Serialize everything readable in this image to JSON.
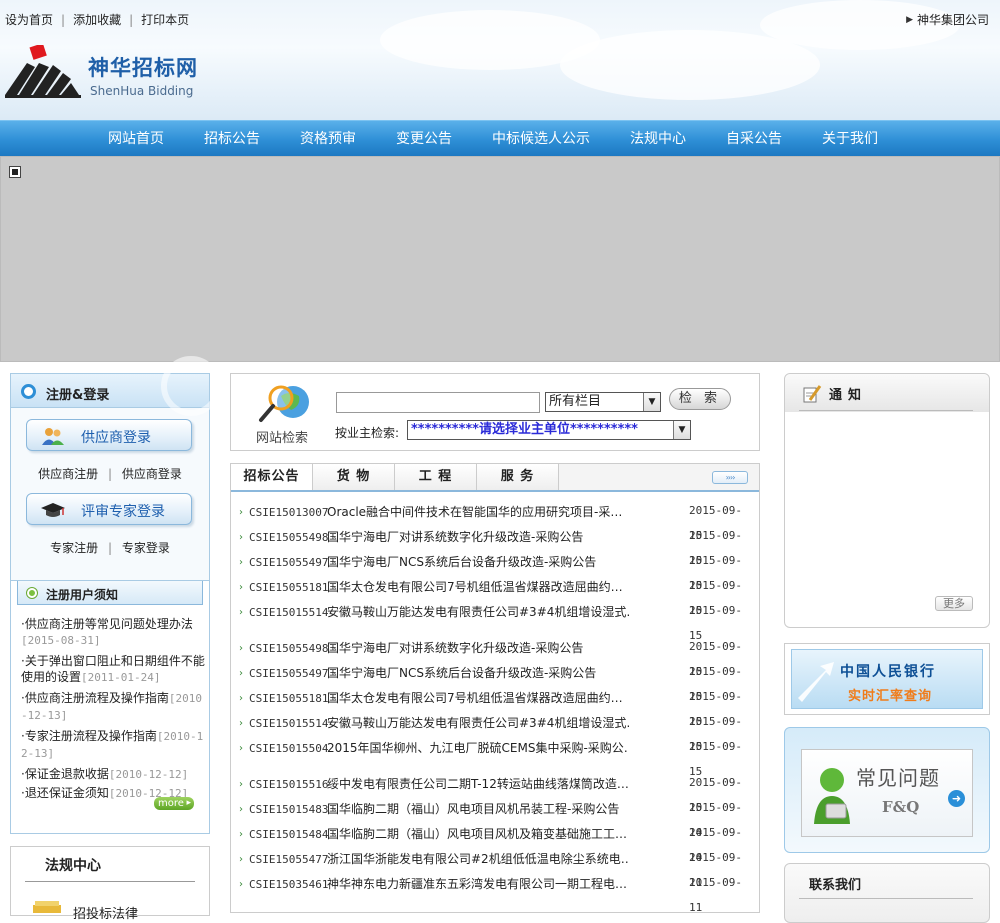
{
  "header": {
    "top_links": [
      "设为首页",
      "添加收藏",
      "打印本页"
    ],
    "group_link": "神华集团公司",
    "logo_cn": "神华招标网",
    "logo_en": "ShenHua Bidding"
  },
  "nav": [
    "网站首页",
    "招标公告",
    "资格预审",
    "变更公告",
    "中标候选人公示",
    "法规中心",
    "自采公告",
    "关于我们"
  ],
  "register": {
    "title": "注册&登录",
    "supplier_button": "供应商登录",
    "supplier_links": [
      "供应商注册",
      "供应商登录"
    ],
    "expert_button": "评审专家登录",
    "expert_links": [
      "专家注册",
      "专家登录"
    ]
  },
  "notices": {
    "title": "注册用户须知",
    "items": [
      {
        "text": "·供应商注册等常见问题处理办法",
        "date": "[2015-08-31]"
      },
      {
        "text": "·关于弹出窗口阻止和日期组件不能使用的设置",
        "date": "[2011-01-24]"
      },
      {
        "text": "·供应商注册流程及操作指南",
        "date": "[2010-12-13]"
      },
      {
        "text": "·专家注册流程及操作指南",
        "date": "[2010-12-13]"
      },
      {
        "text": "·保证金退款收据",
        "date": "[2010-12-12]"
      },
      {
        "text": "·退还保证金须知",
        "date": "[2010-12-12]"
      }
    ],
    "more": "more"
  },
  "law": {
    "title": "法规中心",
    "first_item": "招投标法律"
  },
  "search": {
    "label": "网站检索",
    "input_value": "",
    "category": "所有栏目",
    "button": "检 索",
    "owner_label": "按业主检索:",
    "owner_value": "**********请选择业主单位**********"
  },
  "tabs": [
    "招标公告",
    "货 物",
    "工 程",
    "服 务"
  ],
  "tab_more": "››››",
  "tenders": [
    {
      "code": "CSIE15013007",
      "title": "Oracle融合中间件技术在智能国华的应用研究项目-采…",
      "date": "2015-09-15"
    },
    {
      "code": "CSIE15055498",
      "title": "国华宁海电厂对讲系统数字化升级改造-采购公告",
      "date": "2015-09-15"
    },
    {
      "code": "CSIE15055497",
      "title": "国华宁海电厂NCS系统后台设备升级改造-采购公告",
      "date": "2015-09-15"
    },
    {
      "code": "CSIE15055181",
      "title": "国华太仓发电有限公司7号机组低温省煤器改造屈曲约…",
      "date": "2015-09-15"
    },
    {
      "code": "CSIE15015514",
      "title": "安徽马鞍山万能达发电有限责任公司#3#4机组增设湿式…",
      "date": "2015-09-15"
    },
    {
      "code": "CSIE15055498",
      "title": "国华宁海电厂对讲系统数字化升级改造-采购公告",
      "date": "2015-09-15"
    },
    {
      "code": "CSIE15055497",
      "title": "国华宁海电厂NCS系统后台设备升级改造-采购公告",
      "date": "2015-09-15"
    },
    {
      "code": "CSIE15055181",
      "title": "国华太仓发电有限公司7号机组低温省煤器改造屈曲约…",
      "date": "2015-09-15"
    },
    {
      "code": "CSIE15015514",
      "title": "安徽马鞍山万能达发电有限责任公司#3#4机组增设湿式…",
      "date": "2015-09-15"
    },
    {
      "code": "CSIE15015504",
      "title": "2015年国华柳州、九江电厂脱硫CEMS集中采购-采购公…",
      "date": "2015-09-15"
    },
    {
      "code": "CSIE15015516",
      "title": "绥中发电有限责任公司二期T-12转运站曲线落煤筒改造…",
      "date": "2015-09-15"
    },
    {
      "code": "CSIE15015483",
      "title": "国华临朐二期（福山）风电项目风机吊装工程-采购公告",
      "date": "2015-09-14"
    },
    {
      "code": "CSIE15015484",
      "title": "国华临朐二期（福山）风电项目风机及箱变基础施工工…",
      "date": "2015-09-14"
    },
    {
      "code": "CSIE15055477",
      "title": "浙江国华浙能发电有限公司#2机组低低温电除尘系统电…",
      "date": "2015-09-11"
    },
    {
      "code": "CSIE15035461",
      "title": "神华神东电力新疆准东五彩湾发电有限公司一期工程电…",
      "date": "2015-09-11"
    }
  ],
  "notify": {
    "title": "通知",
    "more": "更多"
  },
  "bank": {
    "name": "中国人民银行",
    "rate": "实时汇率查询"
  },
  "faq": {
    "title": "常见问题",
    "subtitle": "F&Q"
  },
  "contact": {
    "title": "联系我们"
  }
}
